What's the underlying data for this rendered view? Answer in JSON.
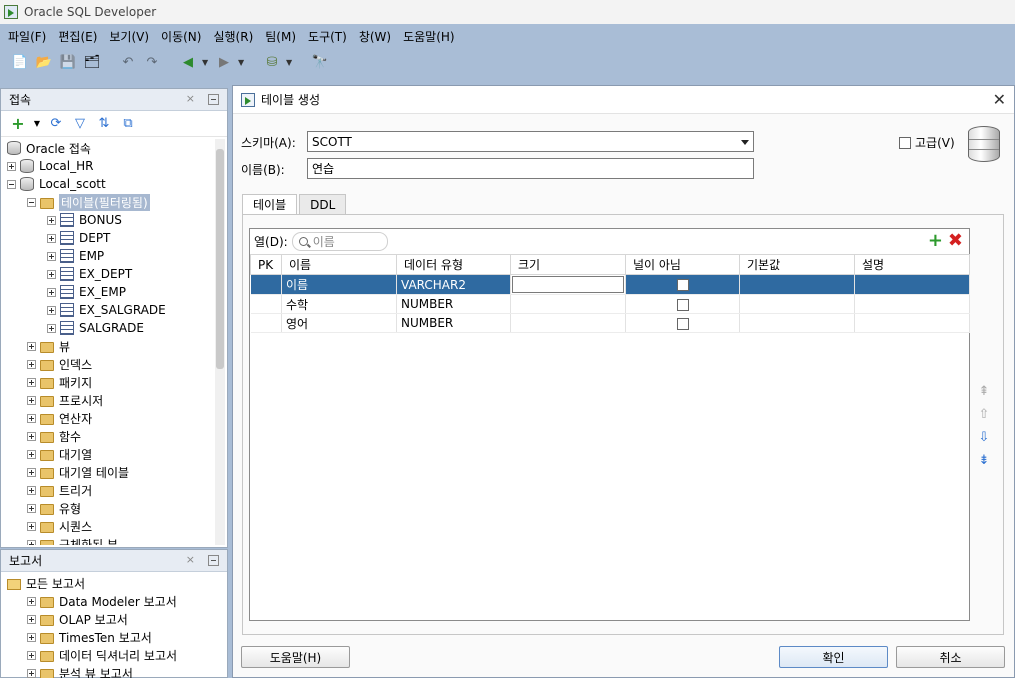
{
  "app": {
    "title": "Oracle SQL Developer"
  },
  "menu": [
    "파일(F)",
    "편집(E)",
    "보기(V)",
    "이동(N)",
    "실행(R)",
    "팀(M)",
    "도구(T)",
    "창(W)",
    "도움말(H)"
  ],
  "connections_panel": {
    "title": "접속",
    "close": "×",
    "tree": [
      {
        "label": "Oracle 접속",
        "level": 0,
        "icon": "db"
      },
      {
        "label": "Local_HR",
        "level": 0,
        "icon": "db",
        "exp": "plus"
      },
      {
        "label": "Local_scott",
        "level": 0,
        "icon": "db",
        "exp": "minus"
      },
      {
        "label": "테이블(필터링됨)",
        "level": 1,
        "icon": "folder",
        "exp": "minus",
        "highlight": true
      },
      {
        "label": "BONUS",
        "level": 2,
        "icon": "table",
        "exp": "plus"
      },
      {
        "label": "DEPT",
        "level": 2,
        "icon": "table",
        "exp": "plus"
      },
      {
        "label": "EMP",
        "level": 2,
        "icon": "table",
        "exp": "plus"
      },
      {
        "label": "EX_DEPT",
        "level": 2,
        "icon": "table",
        "exp": "plus"
      },
      {
        "label": "EX_EMP",
        "level": 2,
        "icon": "table",
        "exp": "plus"
      },
      {
        "label": "EX_SALGRADE",
        "level": 2,
        "icon": "table",
        "exp": "plus"
      },
      {
        "label": "SALGRADE",
        "level": 2,
        "icon": "table",
        "exp": "plus"
      },
      {
        "label": "뷰",
        "level": 1,
        "icon": "folder",
        "exp": "plus"
      },
      {
        "label": "인덱스",
        "level": 1,
        "icon": "folder",
        "exp": "plus"
      },
      {
        "label": "패키지",
        "level": 1,
        "icon": "folder",
        "exp": "plus"
      },
      {
        "label": "프로시저",
        "level": 1,
        "icon": "folder",
        "exp": "plus"
      },
      {
        "label": "연산자",
        "level": 1,
        "icon": "folder",
        "exp": "plus"
      },
      {
        "label": "함수",
        "level": 1,
        "icon": "folder",
        "exp": "plus"
      },
      {
        "label": "대기열",
        "level": 1,
        "icon": "folder",
        "exp": "plus"
      },
      {
        "label": "대기열 테이블",
        "level": 1,
        "icon": "folder",
        "exp": "plus"
      },
      {
        "label": "트리거",
        "level": 1,
        "icon": "folder",
        "exp": "plus"
      },
      {
        "label": "유형",
        "level": 1,
        "icon": "folder",
        "exp": "plus"
      },
      {
        "label": "시퀀스",
        "level": 1,
        "icon": "folder",
        "exp": "plus"
      },
      {
        "label": "구체화된 뷰",
        "level": 1,
        "icon": "folder",
        "exp": "plus"
      }
    ]
  },
  "reports_panel": {
    "title": "보고서",
    "close": "×",
    "tree": [
      {
        "label": "모든 보고서",
        "level": 0,
        "icon": "report"
      },
      {
        "label": "Data Modeler 보고서",
        "level": 1,
        "icon": "folder",
        "exp": "plus"
      },
      {
        "label": "OLAP 보고서",
        "level": 1,
        "icon": "folder",
        "exp": "plus"
      },
      {
        "label": "TimesTen 보고서",
        "level": 1,
        "icon": "folder",
        "exp": "plus"
      },
      {
        "label": "데이터 딕셔너리 보고서",
        "level": 1,
        "icon": "folder",
        "exp": "plus"
      },
      {
        "label": "분석 뷰 보고서",
        "level": 1,
        "icon": "folder",
        "exp": "plus"
      }
    ]
  },
  "dialog": {
    "title": "테이블 생성",
    "schema_label": "스키마(A):",
    "schema_value": "SCOTT",
    "name_label": "이름(B):",
    "name_value": "연습",
    "advanced_label": "고급(V)",
    "tabs": [
      "테이블",
      "DDL"
    ],
    "columns_label": "열(D):",
    "search_placeholder": "이름",
    "headers": [
      "PK",
      "이름",
      "데이터 유형",
      "크기",
      "널이 아님",
      "기본값",
      "설명"
    ],
    "rows": [
      {
        "pk": "",
        "name": "이름",
        "type": "VARCHAR2",
        "size": "",
        "notnull": false,
        "default": "",
        "desc": "",
        "selected": true
      },
      {
        "pk": "",
        "name": "수학",
        "type": "NUMBER",
        "size": "",
        "notnull": false,
        "default": "",
        "desc": ""
      },
      {
        "pk": "",
        "name": "영어",
        "type": "NUMBER",
        "size": "",
        "notnull": false,
        "default": "",
        "desc": ""
      }
    ],
    "help_button": "도움말(H)",
    "ok_button": "확인",
    "cancel_button": "취소"
  }
}
